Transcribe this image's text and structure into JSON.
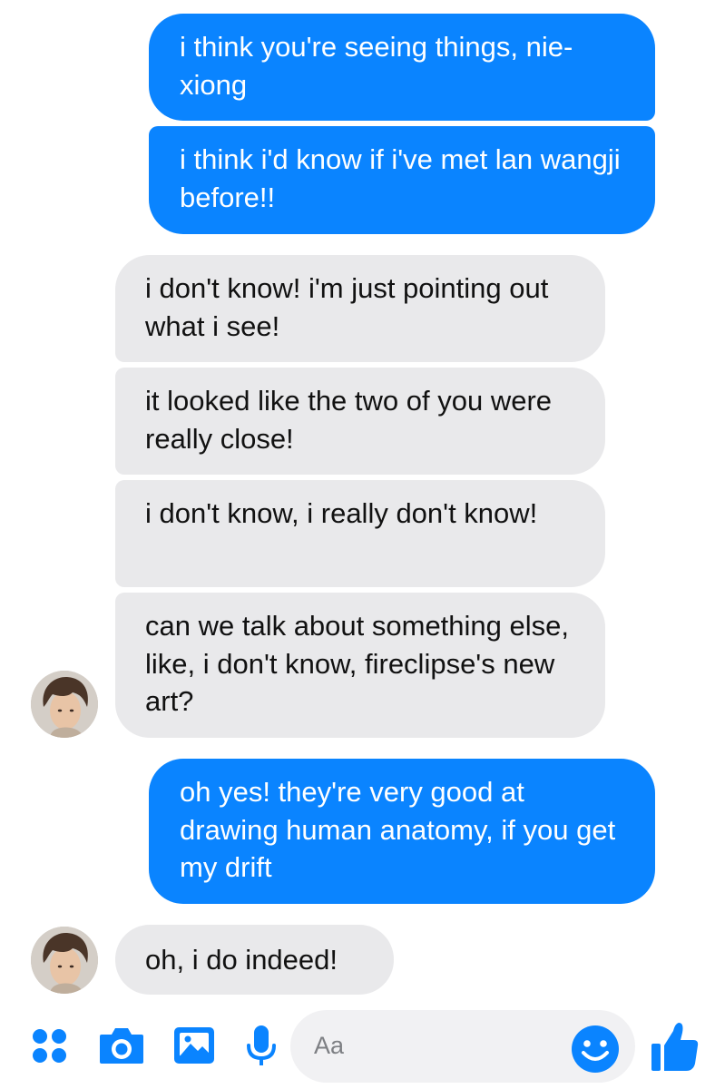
{
  "messages": [
    {
      "direction": "outgoing",
      "text": "i think you're seeing things, nie-xiong"
    },
    {
      "direction": "outgoing",
      "text": "i think i'd know if i've met lan wangji before!!"
    },
    {
      "direction": "incoming",
      "text": "i don't know! i'm just pointing out what i see!"
    },
    {
      "direction": "incoming",
      "text": "it looked like the two of you were really close!"
    },
    {
      "direction": "incoming",
      "text": "i don't know, i really don't know!"
    },
    {
      "direction": "incoming",
      "text": "can we talk about something else, like, i don't know, fireclipse's new art?"
    },
    {
      "direction": "outgoing",
      "text": "oh yes! they're very good at drawing human anatomy, if you get my drift"
    },
    {
      "direction": "incoming",
      "text": "oh, i do indeed!"
    }
  ],
  "composer": {
    "placeholder": "Aa",
    "icons": [
      "menu-dots-icon",
      "camera-icon",
      "gallery-icon",
      "microphone-icon",
      "emoji-icon",
      "thumbs-up-icon"
    ]
  },
  "colors": {
    "outgoing_bubble": "#0a84ff",
    "incoming_bubble": "#e9e9eb",
    "accent": "#0a84ff"
  }
}
